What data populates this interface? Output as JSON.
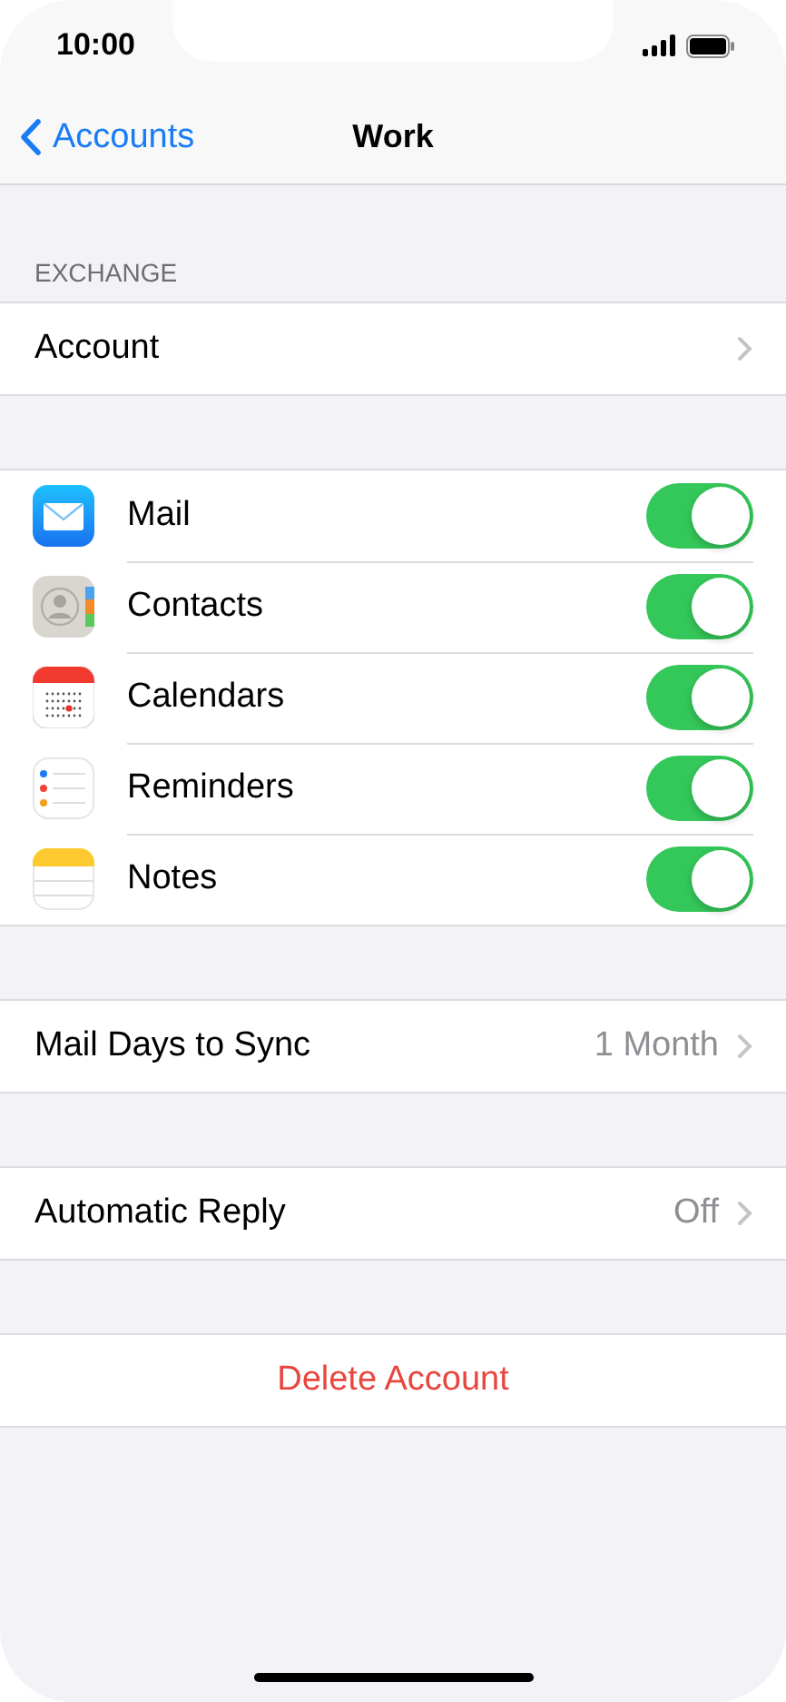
{
  "status_bar": {
    "time": "10:00"
  },
  "nav": {
    "back": "Accounts",
    "title": "Work"
  },
  "section_header": "EXCHANGE",
  "account_row": {
    "label": "Account"
  },
  "services": [
    {
      "kind": "mail",
      "label": "Mail",
      "on": true
    },
    {
      "kind": "contacts",
      "label": "Contacts",
      "on": true
    },
    {
      "kind": "calendar",
      "label": "Calendars",
      "on": true
    },
    {
      "kind": "reminders",
      "label": "Reminders",
      "on": true
    },
    {
      "kind": "notes",
      "label": "Notes",
      "on": true
    }
  ],
  "settings": [
    {
      "label": "Mail Days to Sync",
      "value": "1 Month"
    },
    {
      "label": "Automatic Reply",
      "value": "Off"
    }
  ],
  "delete_button": "Delete Account"
}
